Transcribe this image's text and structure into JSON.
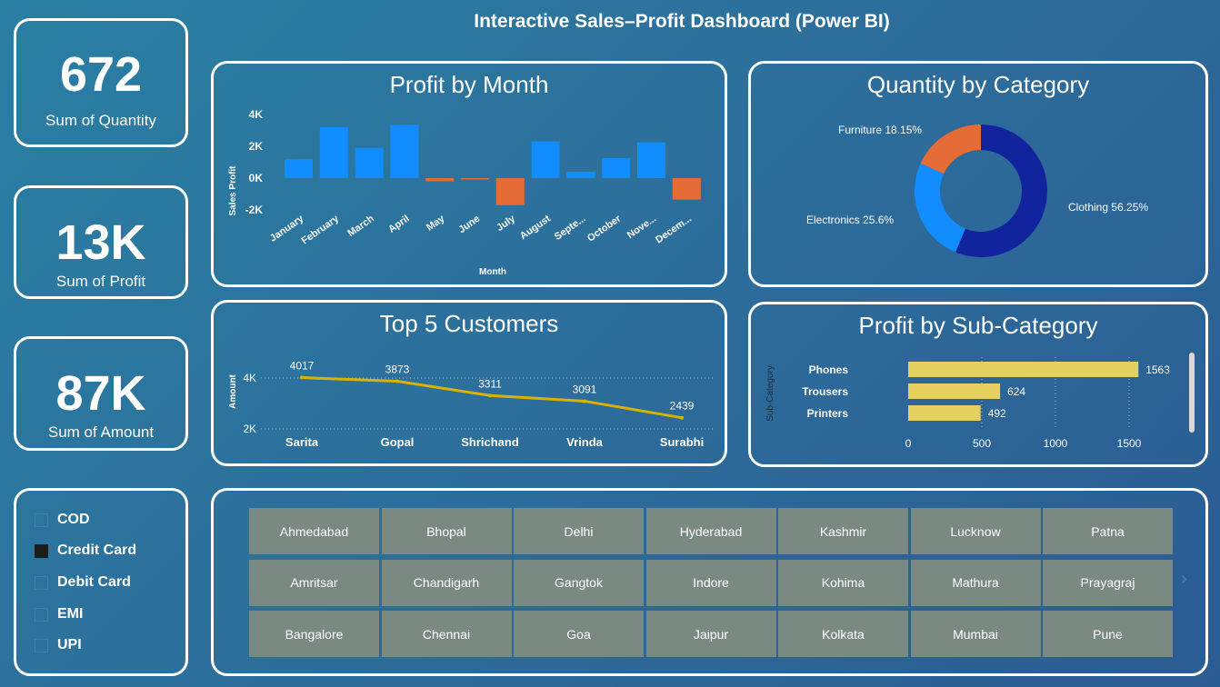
{
  "header": {
    "title": "Interactive Sales–Profit Dashboard (Power BI)"
  },
  "kpis": [
    {
      "value": "672",
      "label": "Sum of Quantity"
    },
    {
      "value": "13K",
      "label": "Sum of Profit"
    },
    {
      "value": "87K",
      "label": "Sum of Amount"
    }
  ],
  "profit_by_month": {
    "title": "Profit by Month",
    "ylabel": "Sales Profit",
    "xlabel": "Month",
    "yticks": [
      "4K",
      "2K",
      "0K",
      "-2K"
    ],
    "months": [
      "January",
      "February",
      "March",
      "April",
      "May",
      "June",
      "July",
      "August",
      "Septe...",
      "October",
      "Nove...",
      "Decem..."
    ]
  },
  "quantity_by_category": {
    "title": "Quantity by Category",
    "labels": [
      "Clothing 56.25%",
      "Electronics 25.6%",
      "Furniture 18.15%"
    ]
  },
  "top5_customers": {
    "title": "Top 5 Customers",
    "ylabel": "Amount",
    "yticks": [
      "4K",
      "2K"
    ],
    "names": [
      "Sarita",
      "Gopal",
      "Shrichand",
      "Vrinda",
      "Surabhi"
    ],
    "value_labels": [
      "4017",
      "3873",
      "3311",
      "3091",
      "2439"
    ]
  },
  "profit_by_subcategory": {
    "title": "Profit by Sub-Category",
    "ylabel": "Sub-Category",
    "names": [
      "Phones",
      "Trousers",
      "Printers"
    ],
    "value_labels": [
      "1563",
      "624",
      "492"
    ],
    "xticks": [
      "0",
      "500",
      "1000",
      "1500"
    ]
  },
  "payment_slicer": {
    "items": [
      {
        "label": "COD",
        "checked": false
      },
      {
        "label": "Credit Card",
        "checked": true
      },
      {
        "label": "Debit Card",
        "checked": false
      },
      {
        "label": "EMI",
        "checked": false
      },
      {
        "label": "UPI",
        "checked": false
      }
    ]
  },
  "city_slicer": {
    "cities": [
      "Ahmedabad",
      "Bhopal",
      "Delhi",
      "Hyderabad",
      "Kashmir",
      "Lucknow",
      "Patna",
      "Amritsar",
      "Chandigarh",
      "Gangtok",
      "Indore",
      "Kohima",
      "Mathura",
      "Prayagraj",
      "Bangalore",
      "Chennai",
      "Goa",
      "Jaipur",
      "Kolkata",
      "Mumbai",
      "Pune"
    ],
    "next_arrow": "›"
  },
  "colors": {
    "bar_positive": "#118dff",
    "bar_negative": "#e66c37",
    "clothing": "#12239e",
    "electronics": "#118dff",
    "furniture": "#e66c37",
    "line": "#d9b300",
    "subcat_bar": "#e8cf62",
    "city_tile": "#7b8983"
  },
  "chart_data": [
    {
      "type": "bar",
      "title": "Profit by Month",
      "xlabel": "Month",
      "ylabel": "Sales Profit",
      "categories": [
        "January",
        "February",
        "March",
        "April",
        "May",
        "June",
        "July",
        "August",
        "September",
        "October",
        "November",
        "December"
      ],
      "values": [
        1200,
        3200,
        1900,
        3350,
        -200,
        -80,
        -1700,
        2300,
        400,
        1250,
        2250,
        -1350
      ],
      "ylim": [
        -2000,
        4000
      ]
    },
    {
      "type": "pie",
      "title": "Quantity by Category",
      "categories": [
        "Clothing",
        "Electronics",
        "Furniture"
      ],
      "values": [
        56.25,
        25.6,
        18.15
      ]
    },
    {
      "type": "line",
      "title": "Top 5 Customers",
      "ylabel": "Amount",
      "categories": [
        "Sarita",
        "Gopal",
        "Shrichand",
        "Vrinda",
        "Surabhi"
      ],
      "values": [
        4017,
        3873,
        3311,
        3091,
        2439
      ],
      "ylim": [
        2000,
        4000
      ]
    },
    {
      "type": "bar",
      "title": "Profit by Sub-Category",
      "ylabel": "Sub-Category",
      "categories": [
        "Phones",
        "Trousers",
        "Printers"
      ],
      "values": [
        1563,
        624,
        492
      ],
      "xlim": [
        0,
        1500
      ]
    }
  ]
}
